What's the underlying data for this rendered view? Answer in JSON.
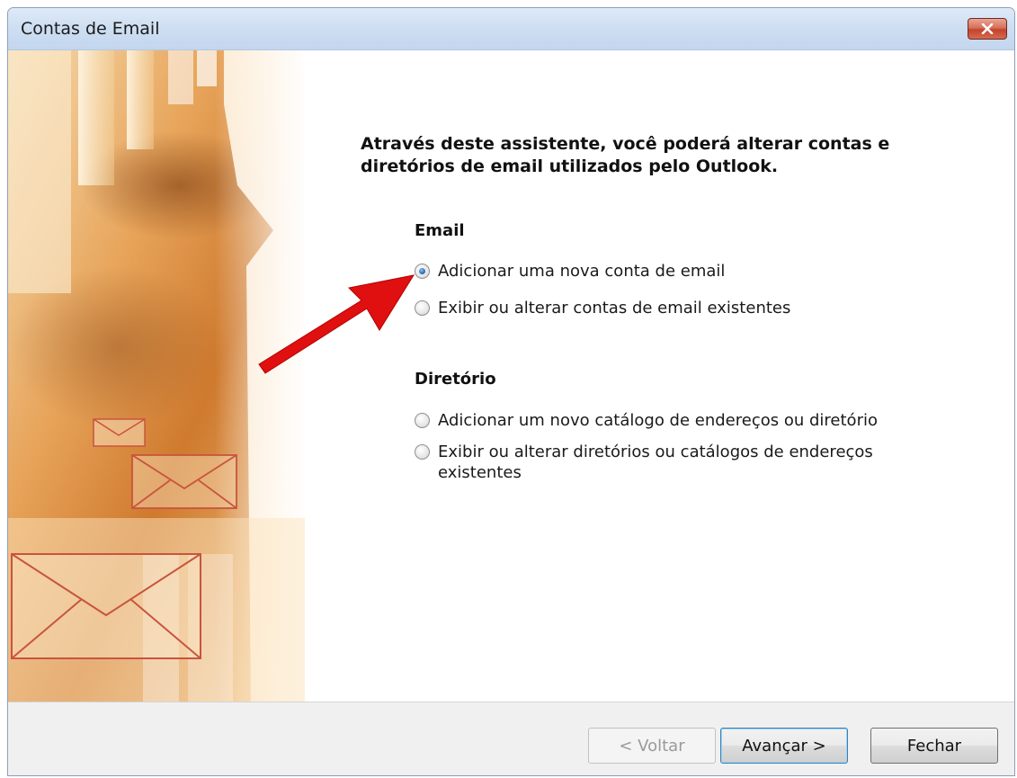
{
  "window": {
    "title": "Contas de Email"
  },
  "main": {
    "intro": "Através deste assistente, você poderá alterar contas e diretórios de email utilizados pelo Outlook.",
    "email_group": {
      "title": "Email",
      "options": [
        {
          "label": "Adicionar uma nova conta de email",
          "checked": true
        },
        {
          "label": "Exibir ou alterar contas de email existentes",
          "checked": false
        }
      ]
    },
    "directory_group": {
      "title": "Diretório",
      "options": [
        {
          "label": "Adicionar um novo catálogo de endereços ou diretório",
          "checked": false
        },
        {
          "label": "Exibir ou alterar diretórios ou catálogos de endereços existentes",
          "checked": false
        }
      ]
    }
  },
  "footer": {
    "back_label": "< Voltar",
    "next_label": "Avançar >",
    "close_label": "Fechar"
  },
  "icons": {
    "close": "close-icon",
    "annotation": "red-arrow-icon"
  },
  "colors": {
    "titlebar": "#cfdff2",
    "close_button": "#c4432c",
    "art_orange": "#d98a3a",
    "annotation_arrow": "#e01010"
  }
}
